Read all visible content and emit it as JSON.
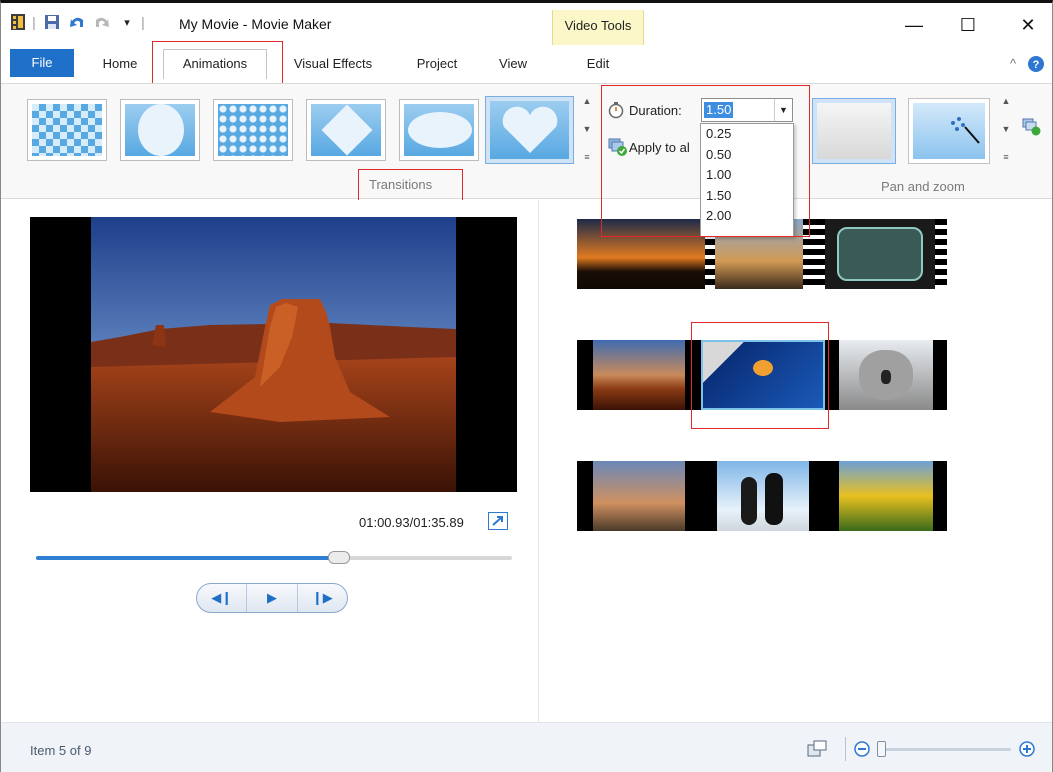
{
  "titlebar": {
    "title": "My Movie - Movie Maker",
    "contextual_group": "Video Tools",
    "minimize": "—",
    "maximize": "☐",
    "close": "✕"
  },
  "tabs": {
    "file": "File",
    "home": "Home",
    "animations": "Animations",
    "visual_effects": "Visual Effects",
    "project": "Project",
    "view": "View",
    "edit": "Edit"
  },
  "ribbon": {
    "transitions_group": "Transitions",
    "pan_zoom_group": "Pan and zoom",
    "duration_label": "Duration:",
    "duration_value": "1.50",
    "apply_label": "Apply to al",
    "duration_options": [
      "0.25",
      "0.50",
      "1.00",
      "1.50",
      "2.00"
    ]
  },
  "player": {
    "timecode": "01:00.93/01:35.89",
    "progress": 0.63
  },
  "status": {
    "item_text": "Item 5 of 9"
  },
  "colors": {
    "accent": "#1e70c9",
    "highlight": "#e02a2a"
  }
}
